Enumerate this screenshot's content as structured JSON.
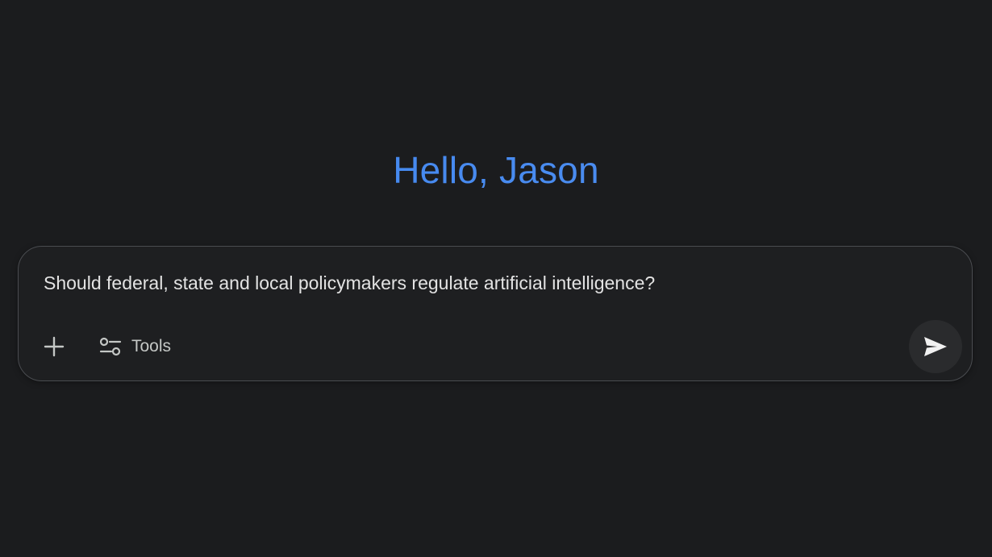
{
  "greeting": "Hello, Jason",
  "composer": {
    "prompt": "Should federal, state and local policymakers regulate artificial intelligence?",
    "tools_label": "Tools",
    "add_icon": "plus-icon",
    "tools_icon": "sliders-icon",
    "send_icon": "send-icon"
  },
  "colors": {
    "background": "#1b1c1e",
    "greeting": "#4285f4",
    "text": "#e3e3e3",
    "muted": "#c4c7c5",
    "border": "#4a4c50"
  }
}
